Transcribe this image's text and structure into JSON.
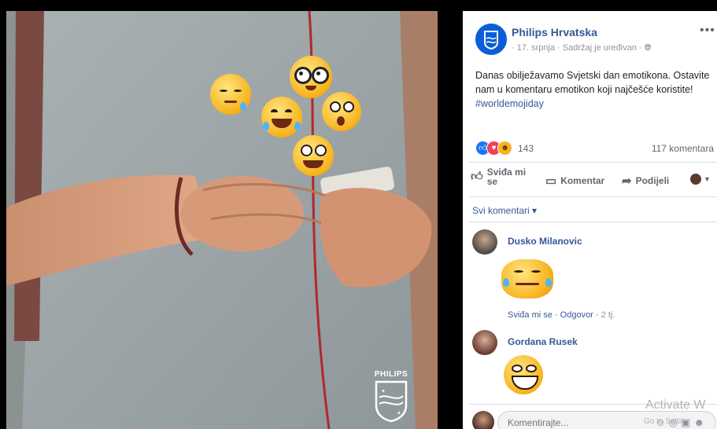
{
  "post": {
    "page_name": "Philips Hrvatska",
    "meta": "· 17. srpnja · Sadržaj je uređivan ·",
    "text": "Danas obilježavamo Svjetski dan emotikona. Ostavite nam u komentaru emotikon koji najčešće koristite!",
    "hashtag": "#worldemojiday",
    "more_label": "•••",
    "reaction_count": "143",
    "comment_count": "117 komentara"
  },
  "photo": {
    "logo_text": "PHILIPS"
  },
  "actions": {
    "like": "Sviđa mi se",
    "comment": "Komentar",
    "share": "Podijeli"
  },
  "filter": "Svi komentari ▾",
  "comments": [
    {
      "author": "Dusko Milanovic",
      "like_label": "Sviđa mi se",
      "reply_label": "Odgovor",
      "time": "2 tj."
    },
    {
      "author": "Gordana Rusek"
    }
  ],
  "composer": {
    "placeholder": "Komentirajte..."
  },
  "overlay": {
    "activate_text": "Activate W",
    "activate_sub": "Go to Settin"
  },
  "colors": {
    "link": "#365899",
    "like_blue": "#1877f2",
    "love_red": "#f33e58",
    "emoji_yellow": "#f7b21b"
  }
}
